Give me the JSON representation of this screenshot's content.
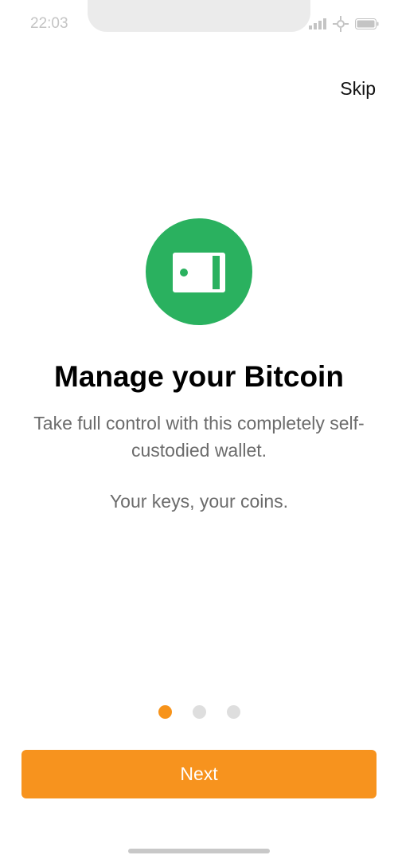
{
  "status_bar": {
    "time": "22:03",
    "icons": [
      "signal-icon",
      "vpn-icon",
      "battery-icon"
    ]
  },
  "skip_label": "Skip",
  "onboarding": {
    "icon": "wallet-icon",
    "title": "Manage your Bitcoin",
    "description": "Take full control with this completely self-custodied wallet.",
    "tagline": "Your keys, your coins."
  },
  "pager": {
    "total": 3,
    "current": 1
  },
  "next_label": "Next",
  "colors": {
    "accent": "#f7931a",
    "icon_bg": "#2ab15f",
    "text_secondary": "#6b6b6b",
    "dot_inactive": "#dedede"
  }
}
